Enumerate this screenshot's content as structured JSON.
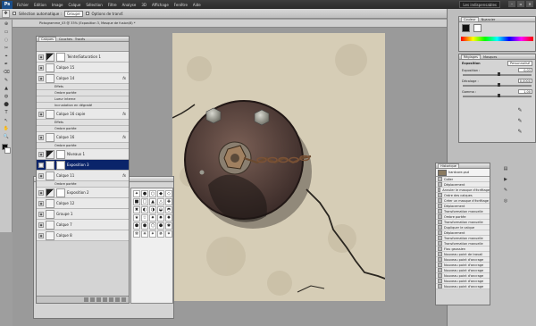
{
  "app": {
    "logo": "Ps",
    "workspace": "Les indispensables"
  },
  "menu": [
    "Fichier",
    "Edition",
    "Image",
    "Calque",
    "Sélection",
    "Filtre",
    "Analyse",
    "3D",
    "Affichage",
    "Fenêtre",
    "Aide"
  ],
  "window_controls": [
    "–",
    "▫",
    "✕"
  ],
  "options_bar": {
    "auto_select_label": "Sélection automatique :",
    "auto_select_value": "Groupe",
    "transform_label": "Options de transf."
  },
  "doc_tab": "Pictogramme_03 @ 33% (Exposition 3, Masque de fusion/8) *",
  "tools": [
    "⊕",
    "▭",
    "◌",
    "✂",
    "⌖",
    "✒",
    "⌫",
    "✎",
    "▲",
    "◍",
    "⬤",
    "T",
    "↖",
    "✋",
    "🔍"
  ],
  "layers_panel": {
    "tabs": [
      "Calques",
      "Couches",
      "Tracés"
    ],
    "rows": [
      {
        "name": "Teinte/Saturation 1",
        "type": "adj"
      },
      {
        "name": "Calque 15",
        "type": "layer"
      },
      {
        "name": "Calque 14",
        "type": "layer",
        "fx": "fx"
      },
      {
        "name": "Effets",
        "type": "sub"
      },
      {
        "name": "Ombre portée",
        "type": "sub"
      },
      {
        "name": "Lueur interne",
        "type": "sub"
      },
      {
        "name": "Incrustation en dégradé",
        "type": "sub"
      },
      {
        "name": "Calque 16 copie",
        "type": "layer",
        "fx": "fx"
      },
      {
        "name": "Effets",
        "type": "sub"
      },
      {
        "name": "Ombre portée",
        "type": "sub"
      },
      {
        "name": "Calque 16",
        "type": "layer",
        "fx": "fx"
      },
      {
        "name": "Ombre portée",
        "type": "sub"
      },
      {
        "name": "Niveaux 1",
        "type": "adj"
      },
      {
        "name": "Exposition 3",
        "type": "selected"
      },
      {
        "name": "Calque 11",
        "type": "layer",
        "fx": "fx"
      },
      {
        "name": "Ombre portée",
        "type": "sub"
      },
      {
        "name": "Exposition 2",
        "type": "adj"
      },
      {
        "name": "Calque 12",
        "type": "layer"
      },
      {
        "name": "Groupe 1",
        "type": "layer"
      },
      {
        "name": "Calque 7",
        "type": "layer"
      },
      {
        "name": "Calque 8",
        "type": "layer"
      }
    ]
  },
  "styles_swatches": [
    "✦",
    "●",
    "○",
    "◆",
    "◇",
    "■",
    "□",
    "▲",
    "△",
    "✚",
    "✖",
    "◐",
    "◑",
    "◒",
    "◓",
    "★",
    "☆",
    "✷",
    "✸",
    "✹",
    "⬟",
    "⬢",
    "⬡",
    "⬣",
    "✱",
    "✲",
    "✳",
    "✴",
    "✵",
    "✶"
  ],
  "color_panel": {
    "tabs": [
      "Couleur",
      "Nuancier"
    ],
    "fg": "#111111",
    "bg": "#ffffff"
  },
  "adjust_panel": {
    "tabs": [
      "Réglages",
      "Masques"
    ],
    "title": "Exposition",
    "preset": "Personnalisé",
    "rows": [
      {
        "label": "Exposition :",
        "value": "0,03"
      },
      {
        "label": "Décalage :",
        "value": "0,0000"
      },
      {
        "label": "Gamma :",
        "value": "1,00"
      }
    ],
    "slider_positions": [
      0.5,
      0.5,
      0.5
    ]
  },
  "history": {
    "tab": "Historique",
    "snapshot": "hardcore.psd",
    "items": [
      "Coller",
      "Déplacement",
      "Annuler le masque d'écrêtage",
      "Ordre des calques",
      "Créer un masque d'écrêtage",
      "Déplacement",
      "Transformation manuelle",
      "Ombre portée",
      "Transformation manuelle",
      "Dupliquer le calque",
      "Déplacement",
      "Transformation manuelle",
      "Transformation manuelle",
      "Flou gaussien",
      "Nouveau point de travail",
      "Nouveau point d'ancrage",
      "Nouveau point d'ancrage",
      "Nouveau point d'ancrage",
      "Nouveau point d'ancrage",
      "Nouveau point d'ancrage",
      "Nouveau point d'ancrage"
    ]
  }
}
